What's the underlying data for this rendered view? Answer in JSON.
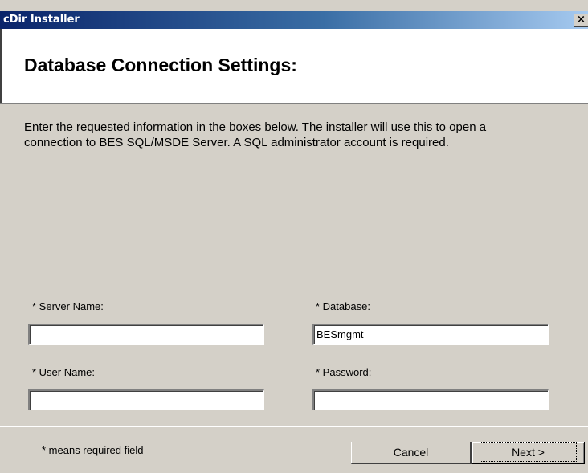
{
  "window": {
    "title": "cDir Installer",
    "close_glyph": "×"
  },
  "header": {
    "title": "Database Connection Settings:"
  },
  "description": "Enter the requested information in the boxes below. The installer will use this to open a\nconnection to BES SQL/MSDE Server.  A SQL administrator account is required.",
  "form": {
    "server_name": {
      "label": "* Server Name:",
      "value": ""
    },
    "database": {
      "label": "* Database:",
      "value": "BESmgmt"
    },
    "user_name": {
      "label": "* User Name:",
      "value": ""
    },
    "password": {
      "label": "* Password:",
      "value": ""
    }
  },
  "footer": {
    "note": "* means required field",
    "cancel_label": "Cancel",
    "next_label": "Next >"
  }
}
